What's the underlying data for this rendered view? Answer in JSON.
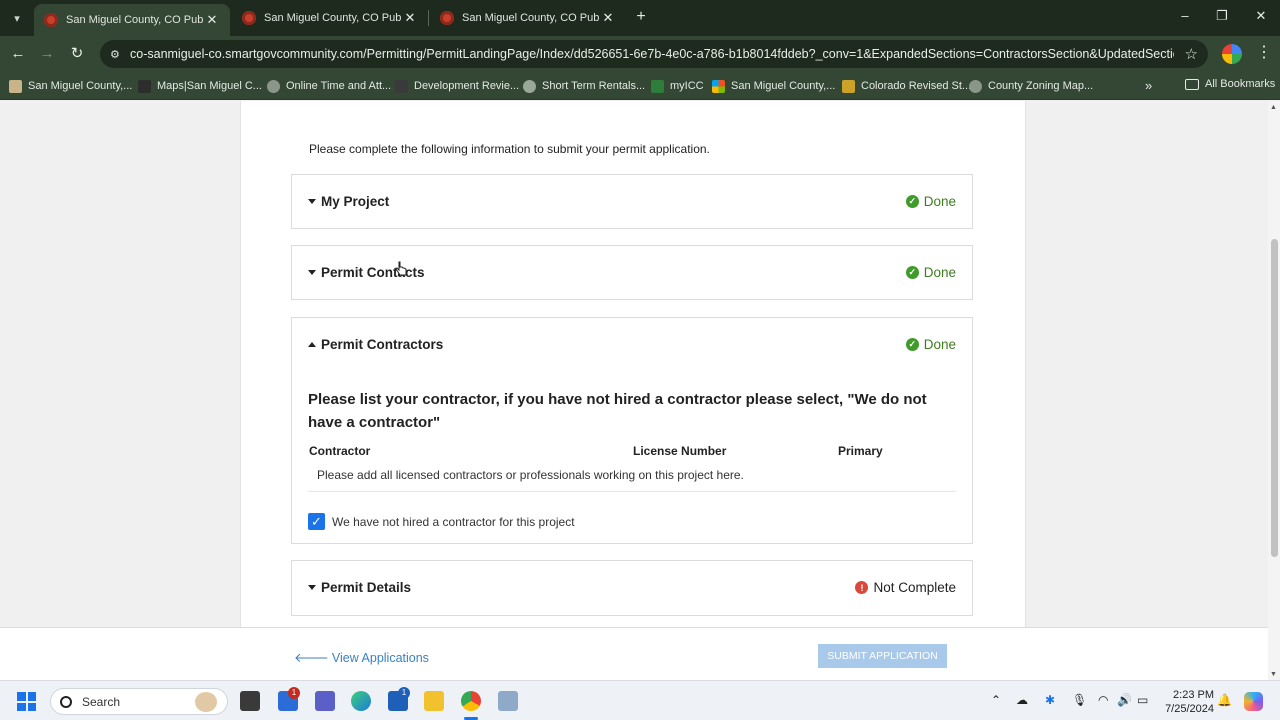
{
  "browser": {
    "tabs": [
      {
        "title": "San Miguel County, CO Public Portal",
        "active": true
      },
      {
        "title": "San Miguel County, CO Public Portal",
        "active": false
      },
      {
        "title": "San Miguel County, CO Public Portal",
        "active": false
      }
    ],
    "url": "co-sanmiguel-co.smartgovcommunity.com/Permitting/PermitLandingPage/Index/dd526651-6e7b-4e0c-a786-b1b8014fddeb?_conv=1&ExpandedSections=ContractorsSection&UpdatedSection=project...",
    "bookmarks": [
      {
        "label": "San Miguel County,...",
        "icon": "san-miguel-icon"
      },
      {
        "label": "Maps|San Miguel C...",
        "icon": "maps-icon"
      },
      {
        "label": "Online Time and Att...",
        "icon": "globe-icon"
      },
      {
        "label": "Development Revie...",
        "icon": "mountain-icon"
      },
      {
        "label": "Short Term Rentals...",
        "icon": "gear-icon"
      },
      {
        "label": "myICC",
        "icon": "icc-icon"
      },
      {
        "label": "San Miguel County,...",
        "icon": "microsoft-icon"
      },
      {
        "label": "Colorado Revised St...",
        "icon": "statute-icon"
      },
      {
        "label": "County Zoning Map...",
        "icon": "globe-icon"
      }
    ],
    "all_bookmarks": "All Bookmarks"
  },
  "page": {
    "intro": "Please complete the following information to submit your permit application.",
    "sections": [
      {
        "title": "My Project",
        "status": "Done"
      },
      {
        "title": "Permit Contacts",
        "status": "Done"
      },
      {
        "title": "Permit Contractors",
        "status": "Done"
      },
      {
        "title": "Permit Details",
        "status": "Not Complete"
      }
    ],
    "contractors": {
      "question": "Please list your contractor, if you have not hired a contractor please select, \"We do not have a contractor\"",
      "columns": [
        "Contractor",
        "License Number",
        "Primary"
      ],
      "empty_message": "Please add all licensed contractors or professionals working on this project here.",
      "checkbox_label": "We have not hired a contractor for this project",
      "checkbox_checked": true
    },
    "footer": {
      "view_applications": "View Applications",
      "submit": "SUBMIT APPLICATION"
    }
  },
  "taskbar": {
    "search_placeholder": "Search",
    "time": "2:23 PM",
    "date": "7/25/2024",
    "badges": [
      "1",
      "1"
    ]
  },
  "colors": {
    "done": "#3f7d1e",
    "not_complete_icon": "#d9493a",
    "link": "#3b82c4",
    "submit_disabled": "#a9c9ea",
    "browser_frame": "#344634"
  }
}
